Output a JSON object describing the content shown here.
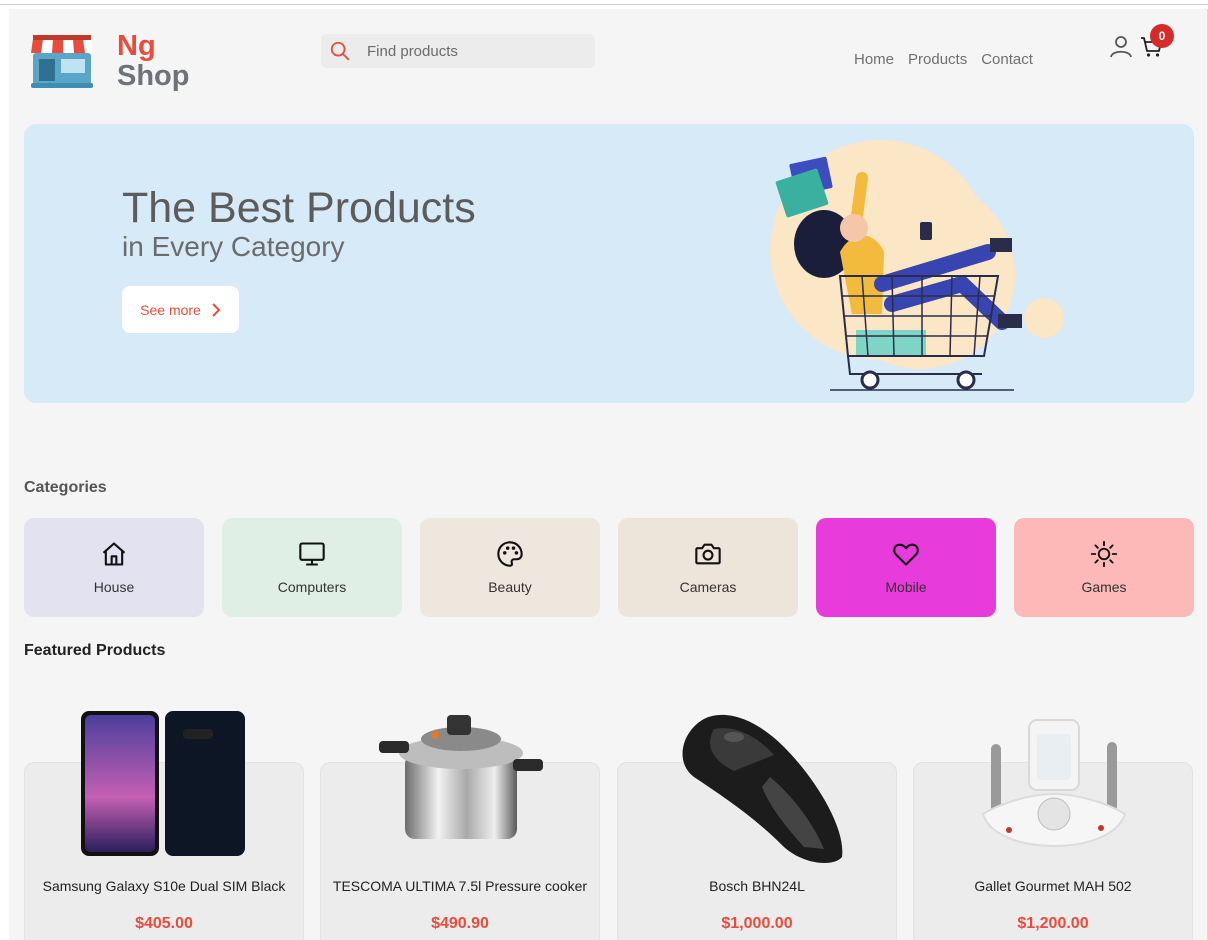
{
  "header": {
    "logo": {
      "line1": "Ng",
      "line2": "Shop"
    },
    "search": {
      "placeholder": "Find products"
    },
    "nav": [
      "Home",
      "Products",
      "Contact"
    ],
    "cart": {
      "count": "0"
    }
  },
  "hero": {
    "title": "The Best Products",
    "subtitle": "in Every Category",
    "button": "See more"
  },
  "categories": {
    "title": "Categories",
    "items": [
      {
        "label": "House",
        "icon": "house-icon",
        "color": "#e3e2f0"
      },
      {
        "label": "Computers",
        "icon": "monitor-icon",
        "color": "#e0efe6"
      },
      {
        "label": "Beauty",
        "icon": "palette-icon",
        "color": "#eee7de"
      },
      {
        "label": "Cameras",
        "icon": "camera-icon",
        "color": "#ede5da"
      },
      {
        "label": "Mobile",
        "icon": "heart-icon",
        "color": "#e83bdc"
      },
      {
        "label": "Games",
        "icon": "sun-icon",
        "color": "#fdb8b8"
      }
    ]
  },
  "featured": {
    "title": "Featured Products",
    "items": [
      {
        "name": "Samsung Galaxy S10e Dual SIM Black",
        "price": "$405.00"
      },
      {
        "name": "TESCOMA ULTIMA 7.5l Pressure cooker",
        "price": "$490.90"
      },
      {
        "name": "Bosch BHN24L",
        "price": "$1,000.00"
      },
      {
        "name": "Gallet Gourmet MAH 502",
        "price": "$1,200.00"
      }
    ]
  },
  "colors": {
    "accent": "#e74c3c",
    "hero_bg": "#d6eaf8",
    "page_bg": "#f5f5f5"
  }
}
